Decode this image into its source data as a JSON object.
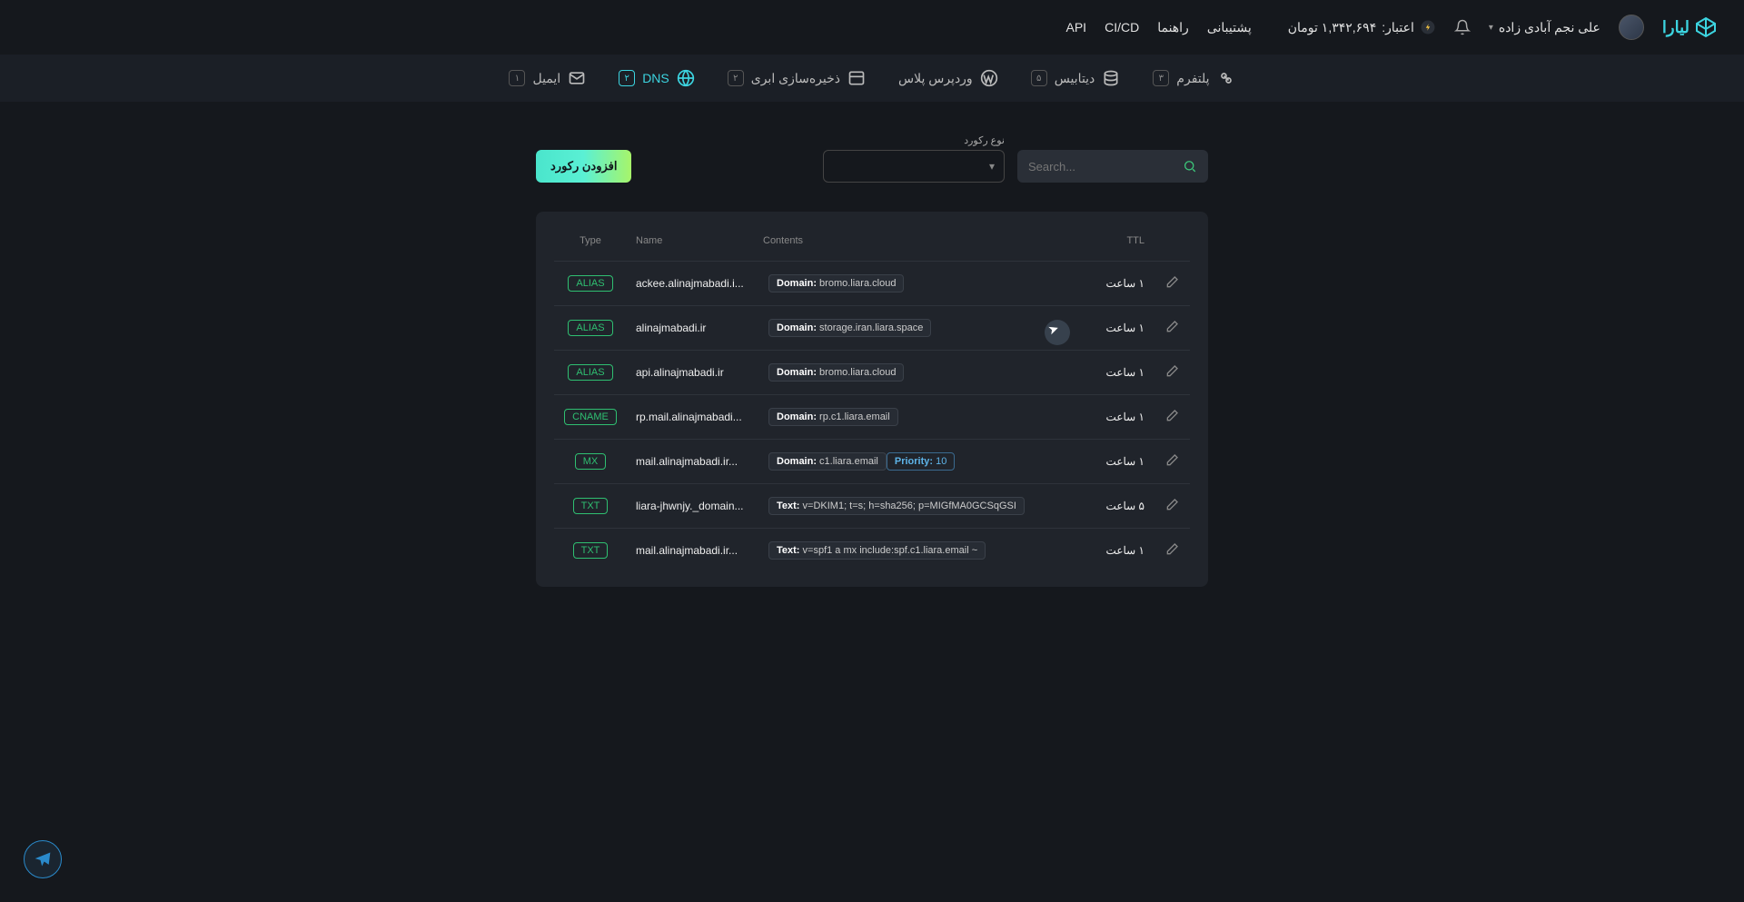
{
  "header": {
    "brand": "لیارا",
    "user_name": "علی نجم آبادی زاده",
    "credit_label": "اعتبار:",
    "credit_amount": "۱,۳۴۲,۶۹۴ تومان",
    "links": {
      "support": "پشتیبانی",
      "guide": "راهنما",
      "cicd": "CI/CD",
      "api": "API"
    }
  },
  "subnav": {
    "platform": {
      "label": "پلتفرم",
      "badge": "۳"
    },
    "database": {
      "label": "دیتابیس",
      "badge": "۵"
    },
    "wordpress": {
      "label": "وردپرس پلاس",
      "badge": ""
    },
    "storage": {
      "label": "ذخیره‌سازی ابری",
      "badge": "۲"
    },
    "dns": {
      "label": "DNS",
      "badge": "۲"
    },
    "email": {
      "label": "ایمیل",
      "badge": "۱"
    }
  },
  "controls": {
    "search_placeholder": "Search...",
    "type_label": "نوع رکورد",
    "add_label": "افزودن رکورد"
  },
  "table": {
    "headers": {
      "type": "Type",
      "name": "Name",
      "contents": "Contents",
      "ttl": "TTL"
    },
    "rows": [
      {
        "type": "ALIAS",
        "name": "ackee.alinajmabadi.i...",
        "domain": "bromo.liara.cloud",
        "ttl": "۱ ساعت"
      },
      {
        "type": "ALIAS",
        "name": "alinajmabadi.ir",
        "domain": "storage.iran.liara.space",
        "ttl": "۱ ساعت"
      },
      {
        "type": "ALIAS",
        "name": "api.alinajmabadi.ir",
        "domain": "bromo.liara.cloud",
        "ttl": "۱ ساعت"
      },
      {
        "type": "CNAME",
        "name": "rp.mail.alinajmabadi...",
        "domain": "rp.c1.liara.email",
        "ttl": "۱ ساعت"
      },
      {
        "type": "MX",
        "name": "mail.alinajmabadi.ir...",
        "domain": "c1.liara.email",
        "priority": "10",
        "ttl": "۱ ساعت"
      },
      {
        "type": "TXT",
        "name": "liara-jhwnjy._domain...",
        "text": "v=DKIM1; t=s; h=sha256; p=MIGfMA0GCSqGSI",
        "ttl": "۵ ساعت"
      },
      {
        "type": "TXT",
        "name": "mail.alinajmabadi.ir...",
        "text": "v=spf1 a mx include:spf.c1.liara.email ~",
        "ttl": "۱ ساعت"
      }
    ],
    "labels": {
      "domain": "Domain:",
      "text": "Text:",
      "priority": "Priority:"
    }
  }
}
